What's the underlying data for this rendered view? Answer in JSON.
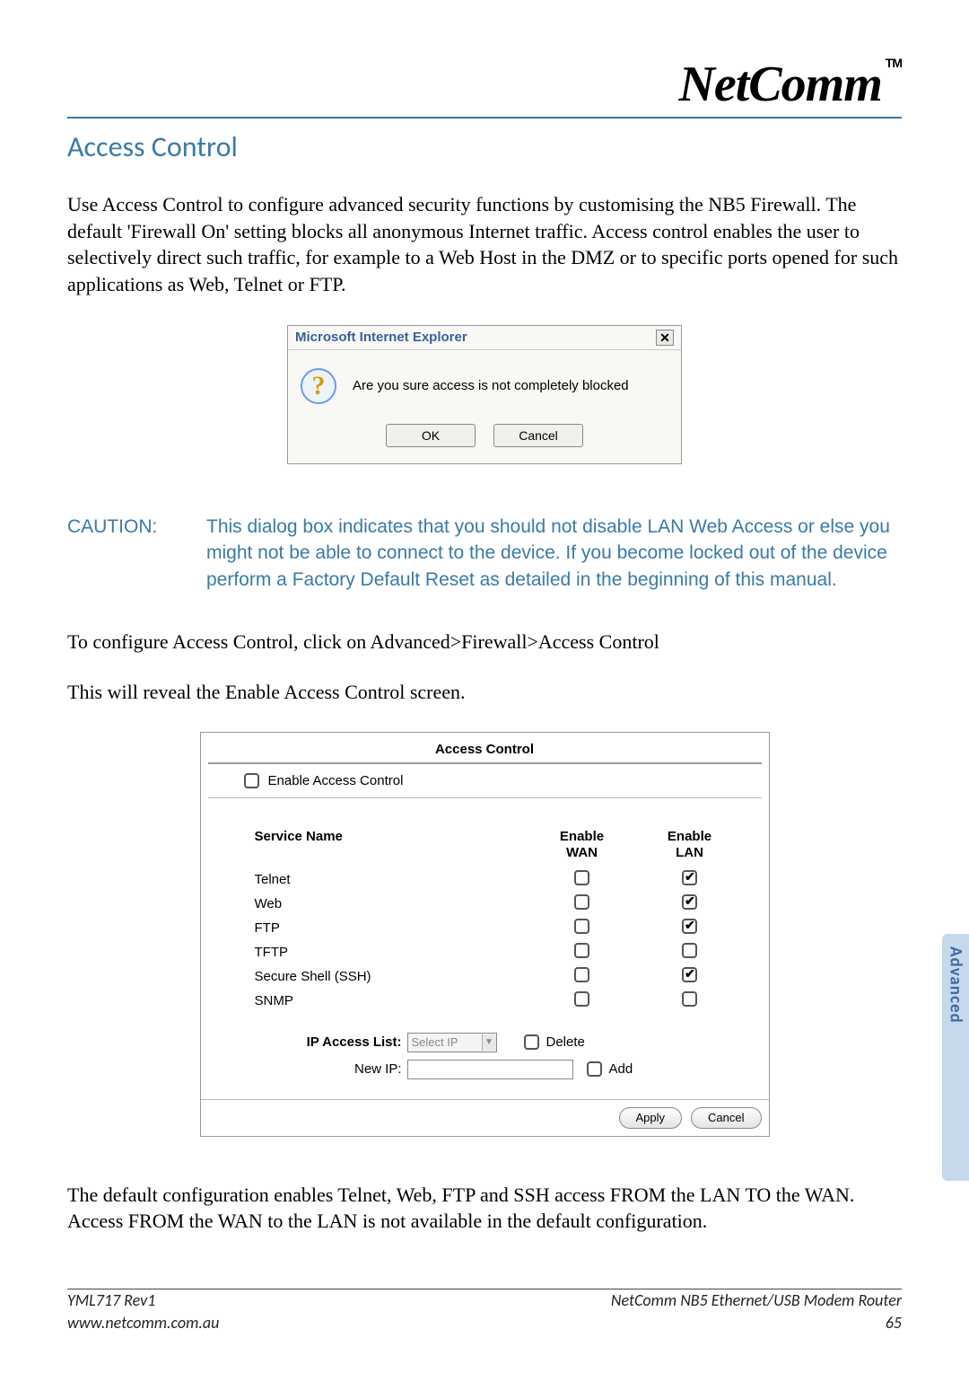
{
  "brand": {
    "name": "NetComm",
    "tm": "TM"
  },
  "section_title": "Access Control",
  "intro": "Use Access Control to configure advanced security functions by customising the NB5 Firewall.  The default 'Firewall On' setting blocks all anonymous Internet traffic.  Access control enables the user to selectively direct such traffic, for example to a Web Host in the DMZ or to specific ports opened for such applications as Web, Telnet or FTP.",
  "dialog": {
    "title": "Microsoft Internet Explorer",
    "close": "✕",
    "icon": "?",
    "message": "Are you sure access is not completely blocked",
    "ok": "OK",
    "cancel": "Cancel"
  },
  "caution_label": "CAUTION:",
  "caution_text": "This dialog box indicates that you should not disable LAN Web Access or else you might not be able to connect to the device. If you become locked out of the device  perform a Factory Default Reset as detailed in the beginning of this manual.",
  "para_nav": "To configure Access Control, click on Advanced>Firewall>Access Control",
  "para_reveal": "This will reveal the Enable Access Control screen.",
  "panel": {
    "title": "Access Control",
    "enable_label": "Enable Access Control",
    "head_service": "Service Name",
    "head_wan": "Enable\nWAN",
    "head_lan": "Enable\nLAN",
    "services": [
      {
        "name": "Telnet",
        "wan": false,
        "lan": true
      },
      {
        "name": "Web",
        "wan": false,
        "lan": true
      },
      {
        "name": "FTP",
        "wan": false,
        "lan": true
      },
      {
        "name": "TFTP",
        "wan": false,
        "lan": false
      },
      {
        "name": "Secure Shell (SSH)",
        "wan": false,
        "lan": true
      },
      {
        "name": "SNMP",
        "wan": false,
        "lan": false
      }
    ],
    "ip_list_label": "IP Access List:",
    "ip_select_placeholder": "Select IP",
    "delete_label": "Delete",
    "new_ip_label": "New IP:",
    "add_label": "Add",
    "apply": "Apply",
    "cancel": "Cancel"
  },
  "closing": "The default configuration enables Telnet, Web, FTP and SSH access FROM the LAN TO the WAN.  Access FROM the WAN to the LAN is not available in the default configuration.",
  "side_tab": "Advanced",
  "footer": {
    "left1": "YML717 Rev1",
    "right1": "NetComm NB5 Ethernet/USB Modem Router",
    "left2": "www.netcomm.com.au",
    "right2": "65"
  }
}
